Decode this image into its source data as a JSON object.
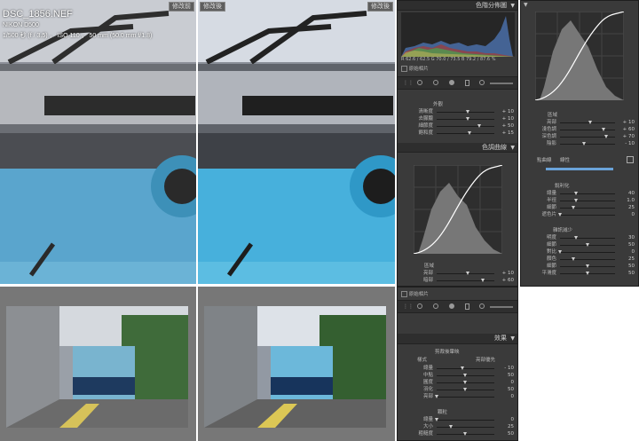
{
  "photo_info": {
    "filename": "DSC_1856.NEF",
    "camera": "NIKON D500",
    "exposure": "1/500 秒 (f / 3.5) ， ISO 110 ， 50 mm (50.0 mm f/1.8)"
  },
  "compare_tags": {
    "before": "修改前",
    "after": "修改後"
  },
  "histogram_panel": {
    "title": "色階分佈圖",
    "readout": "R 62.6 / 62.5 G 70.0 / 73.5 B 79.2 / 87.6 %",
    "original_photo": "原始相片"
  },
  "basic_panel": {
    "title": "外觀",
    "sliders": [
      {
        "label": "清晰度",
        "value": "+ 10",
        "pos": 0.55
      },
      {
        "label": "去朦朧",
        "value": "+ 10",
        "pos": 0.55
      },
      {
        "label": "細節度",
        "value": "+ 50",
        "pos": 0.75
      },
      {
        "label": "飽和度",
        "value": "+ 15",
        "pos": 0.57
      }
    ]
  },
  "tone_curve_panel": {
    "title": "色調曲線",
    "region_title": "區域",
    "sliders": [
      {
        "label": "亮部",
        "value": "+ 10",
        "pos": 0.55
      },
      {
        "label": "暗部",
        "value": "+ 60",
        "pos": 0.8
      }
    ]
  },
  "right_curve": {
    "region_title": "區域",
    "sliders": [
      {
        "label": "亮部",
        "value": "+ 10",
        "pos": 0.55
      },
      {
        "label": "淺色調",
        "value": "+ 60",
        "pos": 0.8
      },
      {
        "label": "深色調",
        "value": "+ 70",
        "pos": 0.85
      },
      {
        "label": "陰影",
        "value": "- 10",
        "pos": 0.45
      }
    ],
    "point_curve_label": "點曲線",
    "point_curve_value": "線性"
  },
  "sharpen_panel": {
    "title": "銳利化",
    "sliders": [
      {
        "label": "總量",
        "value": "40",
        "pos": 0.3
      },
      {
        "label": "半徑",
        "value": "1.0",
        "pos": 0.3
      },
      {
        "label": "細節",
        "value": "25",
        "pos": 0.25
      },
      {
        "label": "遮色片",
        "value": "0",
        "pos": 0.0
      }
    ]
  },
  "noise_panel": {
    "title": "雜訊減少",
    "sliders": [
      {
        "label": "明度",
        "value": "30",
        "pos": 0.3
      },
      {
        "label": "細節",
        "value": "50",
        "pos": 0.5
      },
      {
        "label": "對比",
        "value": "0",
        "pos": 0.0
      },
      {
        "label": "顏色",
        "value": "25",
        "pos": 0.25
      },
      {
        "label": "細節",
        "value": "50",
        "pos": 0.5
      },
      {
        "label": "平滑度",
        "value": "50",
        "pos": 0.5
      }
    ]
  },
  "original_photo_2": "原始相片",
  "effects_panel": {
    "title": "效果",
    "vignette_title": "剪裁後暈映",
    "style_label": "樣式",
    "style_value": "亮部優先",
    "sliders": [
      {
        "label": "總量",
        "value": "- 10",
        "pos": 0.45
      },
      {
        "label": "中點",
        "value": "50",
        "pos": 0.5
      },
      {
        "label": "圓度",
        "value": "0",
        "pos": 0.5
      },
      {
        "label": "羽化",
        "value": "50",
        "pos": 0.5
      },
      {
        "label": "亮部",
        "value": "0",
        "pos": 0.0
      }
    ],
    "grain_title": "顆粒",
    "grain_sliders": [
      {
        "label": "總量",
        "value": "0",
        "pos": 0.0
      },
      {
        "label": "大小",
        "value": "25",
        "pos": 0.25
      },
      {
        "label": "粗糙度",
        "value": "50",
        "pos": 0.5
      }
    ]
  },
  "colors": {
    "panel_bg": "#3a3a3a",
    "header_bg": "#2e2e2e",
    "accent": "#6aa3d9"
  }
}
